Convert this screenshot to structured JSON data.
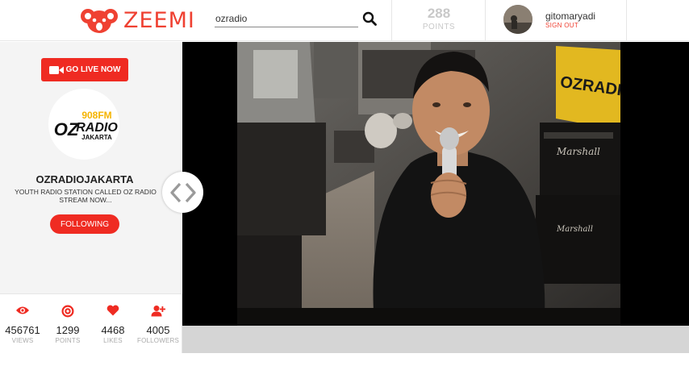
{
  "header": {
    "brand": "ZEEMI",
    "search_value": "ozradio",
    "points_value": "288",
    "points_label": "POINTS",
    "username": "gitomaryadi",
    "signout_label": "SIGN OUT"
  },
  "left": {
    "go_live_label": "GO LIVE NOW",
    "channel_name": "OZRADIOJAKARTA",
    "channel_description": "YOUTH RADIO STATION CALLED OZ RADIO STREAM NOW...",
    "follow_label": "FOLLOWING",
    "logo": {
      "freq": "908FM",
      "oz": "OZ",
      "radio": "RADIO",
      "city": "JAKARTA"
    }
  },
  "stats": [
    {
      "icon": "eye-icon",
      "value": "456761",
      "label": "VIEWS"
    },
    {
      "icon": "points-icon",
      "value": "1299",
      "label": "POINTS"
    },
    {
      "icon": "heart-icon",
      "value": "4468",
      "label": "LIKES"
    },
    {
      "icon": "add-user-icon",
      "value": "4005",
      "label": "FOLLOWERS"
    }
  ],
  "video": {
    "sign_text": "OZRADIO",
    "amp_brand": "Marshall"
  },
  "colors": {
    "accent": "#ef2b22",
    "brand": "#ef4132",
    "muted": "#c8c8c8"
  }
}
